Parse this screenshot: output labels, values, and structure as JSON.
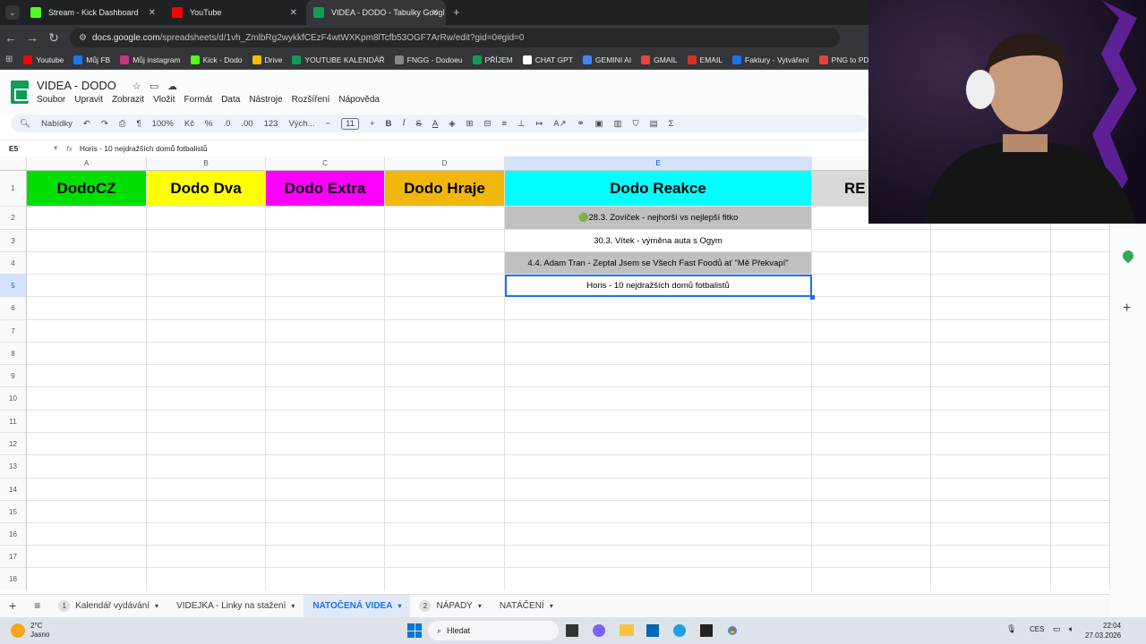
{
  "browser": {
    "tabs": [
      {
        "title": "Stream - Kick Dashboard",
        "icon": "kick-icon",
        "color": "#53fc18",
        "active": false
      },
      {
        "title": "YouTube",
        "icon": "youtube-icon",
        "color": "#ff0000",
        "active": false
      },
      {
        "title": "VIDEA - DODO - Tabulky Googl",
        "icon": "sheets-icon",
        "color": "#0f9d58",
        "active": true
      }
    ],
    "new_tab": "+",
    "url_domain": "docs.google.com",
    "url_path": "/spreadsheets/d/1vh_ZmlbRg2wykkfCEzF4wtWXKpm8lTcfb53OGF7ArRw/edit?gid=0#gid=0",
    "bookmarks": [
      {
        "label": "Youtube",
        "color": "#ff0000"
      },
      {
        "label": "Můj FB",
        "color": "#1877f2"
      },
      {
        "label": "Můj instagram",
        "color": "#c13584"
      },
      {
        "label": "Kick - Dodo",
        "color": "#53fc18"
      },
      {
        "label": "Drive",
        "color": "#fbbc04"
      },
      {
        "label": "YOUTUBE KALENDÁŘ",
        "color": "#0f9d58"
      },
      {
        "label": "FNGG - Dodoeu",
        "color": "#888888"
      },
      {
        "label": "PŘÍJEM",
        "color": "#0f9d58"
      },
      {
        "label": "CHAT GPT",
        "color": "#ffffff"
      },
      {
        "label": "GEMINI AI",
        "color": "#4285f4"
      },
      {
        "label": "GMAIL",
        "color": "#ea4335"
      },
      {
        "label": "EMAIL",
        "color": "#d93025"
      },
      {
        "label": "Faktury - Vytváření",
        "color": "#1a73e8"
      },
      {
        "label": "PNG to PDF",
        "color": "#ea4335"
      }
    ]
  },
  "sheets": {
    "title": "VIDEA - DODO",
    "menu": [
      "Soubor",
      "Upravit",
      "Zobrazit",
      "Vložit",
      "Formát",
      "Data",
      "Nástroje",
      "Rozšíření",
      "Nápověda"
    ],
    "toolbar": {
      "search": "Nabídky",
      "zoom": "100%",
      "currency": "Kč",
      "percent": "%",
      "dec_minus": ".0",
      "dec_plus": ".00",
      "number": "123",
      "font": "Vých...",
      "font_size": "11"
    },
    "cell_ref": "E5",
    "formula": "Horis - 10 nejdražších domů fotbalistů",
    "columns": [
      "A",
      "B",
      "C",
      "D",
      "E"
    ],
    "headers": [
      {
        "text": "DodoCZ",
        "color": "#00e000"
      },
      {
        "text": "Dodo Dva",
        "color": "#ffff00"
      },
      {
        "text": "Dodo Extra",
        "color": "#ff00ff"
      },
      {
        "text": "Dodo Hraje",
        "color": "#f1b80b"
      },
      {
        "text": "Dodo Reakce",
        "color": "#00ffff"
      },
      {
        "text": "RE",
        "color": "#d9d9d9"
      }
    ],
    "rows": [
      "1",
      "2",
      "3",
      "4",
      "5",
      "6",
      "7",
      "8",
      "9",
      "10",
      "11",
      "12",
      "13",
      "14",
      "15",
      "16",
      "17",
      "18"
    ],
    "e_cells": [
      {
        "text": "🟢28.3. Zovíček - nejhorší vs nejlepší fitko",
        "bg": "#c0c0c0"
      },
      {
        "text": "30.3. Vítek - výměna auta s Ogym",
        "bg": "#ffffff"
      },
      {
        "text": "4.4. Adam Tran - Zeptal Jsem se Všech Fast Foodů ať \"Mě Překvapí\"",
        "bg": "#c0c0c0"
      },
      {
        "text": "Horis - 10 nejdražších domů fotbalistů",
        "bg": "#ffffff"
      }
    ],
    "sheet_tabs": [
      {
        "label": "Kalendář vydávání",
        "badge": "1",
        "active": false
      },
      {
        "label": "VIDEJKA - Linky na stažení",
        "badge": "",
        "active": false
      },
      {
        "label": "NATOČENÁ VIDEA",
        "badge": "",
        "active": true
      },
      {
        "label": "NÁPADY",
        "badge": "2",
        "active": false
      },
      {
        "label": "NATÁČENÍ",
        "badge": "",
        "active": false
      }
    ]
  },
  "taskbar": {
    "temp": "2°C",
    "weather": "Jasno",
    "search": "Hledat",
    "lang": "CES",
    "time": "22:04",
    "date": "27.03.2026"
  }
}
